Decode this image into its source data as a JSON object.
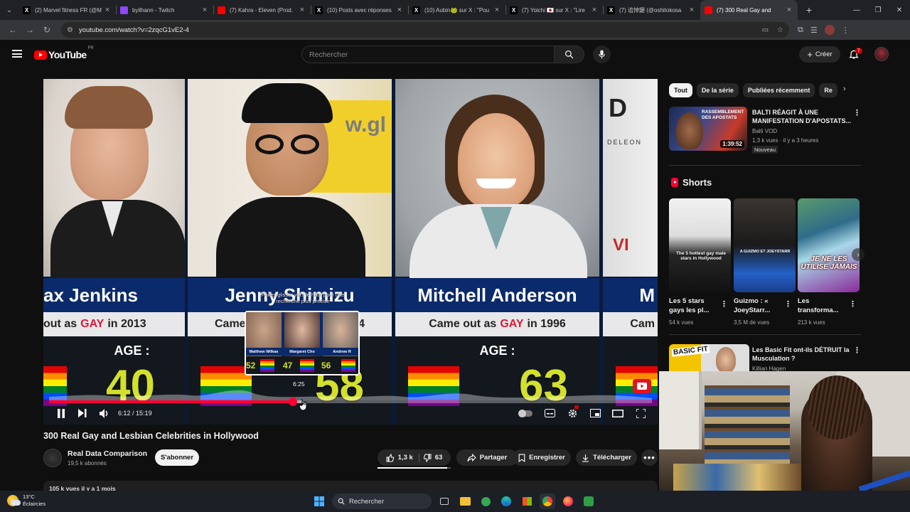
{
  "browser": {
    "tabs": [
      {
        "title": "(2) Marvel fitness FR (@M",
        "icon": "x-icon",
        "icon_char": "X",
        "icon_bg": "#000000",
        "active": false
      },
      {
        "title": "byilhann - Twitch",
        "icon": "twitch-icon",
        "icon_char": "",
        "icon_bg": "#9146ff",
        "active": false
      },
      {
        "title": "(7) Kahra - Eleven (Prod. ",
        "icon": "youtube-icon",
        "icon_char": "",
        "icon_bg": "#ff0000",
        "active": false
      },
      {
        "title": "(10) Posts avec réponses",
        "icon": "x-icon",
        "icon_char": "X",
        "icon_bg": "#000000",
        "active": false
      },
      {
        "title": "(10) Aubin🐸 sur X : \"Pou",
        "icon": "x-icon",
        "icon_char": "X",
        "icon_bg": "#000000",
        "active": false
      },
      {
        "title": "(7) Yoichi 🇯🇵 sur X : \"Lire",
        "icon": "x-icon",
        "icon_char": "X",
        "icon_bg": "#000000",
        "active": false
      },
      {
        "title": "(7) 追悼鍵 (@oshitokosa",
        "icon": "x-icon",
        "icon_char": "X",
        "icon_bg": "#000000",
        "active": false
      },
      {
        "title": "(7) 300 Real Gay and",
        "icon": "youtube-icon",
        "icon_char": "",
        "icon_bg": "#ff0000",
        "active": true
      }
    ],
    "url": "youtube.com/watch?v=2zqcG1vE2-4"
  },
  "yt": {
    "logo_text": "YouTube",
    "country": "FR",
    "search_placeholder": "Rechercher",
    "create_label": "Créer",
    "notif_count": "7"
  },
  "video": {
    "columns": [
      {
        "name": "ax Jenkins",
        "out_prefix": "out as",
        "out_word": "GAY",
        "out_suffix": "in 2013",
        "age_label": "AGE :",
        "age": "40"
      },
      {
        "name": "Jenny Shimizu",
        "out_prefix": "Came",
        "out_word": "",
        "out_suffix": "4",
        "age_label": "",
        "age": "58"
      },
      {
        "name": "Mitchell Anderson",
        "out_prefix": "Came out as",
        "out_word": "GAY",
        "out_suffix": "in 1996",
        "age_label": "AGE :",
        "age": "63"
      },
      {
        "name": "M",
        "out_prefix": "Cam",
        "out_word": "",
        "out_suffix": "",
        "age_label": "",
        "age": ""
      }
    ],
    "preview": {
      "caption": "Faites glisser vers le haut pour une recherche plus précise",
      "names": [
        "Matthew Wilkas",
        "Margaret Cho",
        "Andrew R"
      ],
      "ages": [
        "52",
        "47",
        "56"
      ],
      "hover_time": "6:25"
    },
    "time_current": "6:12",
    "time_separator": " / ",
    "time_total": "15:19",
    "progress_pct": 40.5,
    "hover_pct": 42.3,
    "title": "300 Real Gay and Lesbian Celebrities in Hollywood",
    "channel": "Real Data Comparison",
    "subscribers": "19,5 k abonnés",
    "subscribe_label": "S'abonner",
    "likes": "1,3 k",
    "dislikes": "63",
    "like_ratio": 0.95,
    "share_label": "Partager",
    "save_label": "Enregistrer",
    "download_label": "Télécharger",
    "views_line": "105 k vues  il y a 1 mois"
  },
  "sidebar": {
    "chips": [
      "Tout",
      "De la série",
      "Publiées récemment",
      "Re"
    ],
    "rec1": {
      "title": "BALTI RÉAGIT À UNE MANIFESTATION D'APOSTATS...",
      "channel": "Balti VOD",
      "meta": "1,3 k vues · il y a 3 heures",
      "badge": "Nouveau",
      "duration": "1:39:52",
      "thumb_text": "RASSEMBLEMENT DES APOSTATS"
    },
    "shorts_label": "Shorts",
    "shorts": [
      {
        "title": "Les 5 stars gays les pl...",
        "views": "54 k vues",
        "overlay": "The 5 hottest gay male stars in Hollywood"
      },
      {
        "title": "Guizmo : « JoeyStarr...",
        "views": "3,5 M de vues",
        "overlay": "A GUIZMO ET JOEYSTARR"
      },
      {
        "title": "Les transforma...",
        "views": "213 k vues",
        "overlay": "JE NE LES UTILISE JAMAIS"
      }
    ],
    "rec2": {
      "title": "Les Basic Fit ont-ils DÉTRUIT la Musculation ?",
      "channel": "Killian Hagen",
      "thumb_text": "BASIC FIT"
    }
  },
  "taskbar": {
    "temp": "13°C",
    "weather": "Éclaircies",
    "search": "Rechercher"
  }
}
